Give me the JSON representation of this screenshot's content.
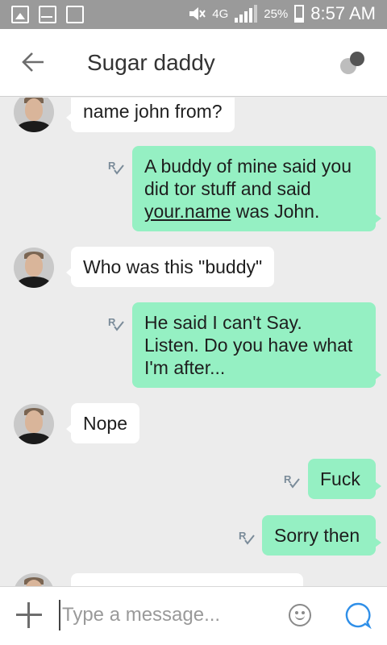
{
  "status_bar": {
    "network": "4G",
    "battery_percent": "25%",
    "time": "8:57 AM",
    "icons": [
      "image-icon",
      "mail-icon",
      "screenshot-icon",
      "mute-icon",
      "signal-icon",
      "battery-icon"
    ]
  },
  "header": {
    "title": "Sugar daddy",
    "back_icon": "arrow-left-icon",
    "contact_icon": "contact-icon"
  },
  "messages": [
    {
      "direction": "in",
      "lines": [
        "name john from?"
      ]
    },
    {
      "direction": "out",
      "lines": [
        "A buddy of mine said you",
        "did tor stuff and said",
        "your.name was John."
      ],
      "underlined": "your.name"
    },
    {
      "direction": "in",
      "lines": [
        "Who was this \"buddy\""
      ]
    },
    {
      "direction": "out",
      "lines": [
        "He said I can't Say.",
        "Listen. Do you have what",
        "I'm after..."
      ]
    },
    {
      "direction": "in",
      "lines": [
        "Nope"
      ]
    },
    {
      "direction": "out",
      "lines": [
        "Fuck"
      ]
    },
    {
      "direction": "out",
      "lines": [
        "Sorry then"
      ]
    }
  ],
  "input": {
    "placeholder": "Type a message...",
    "value": ""
  },
  "colors": {
    "outgoing_bubble": "#95f0c3",
    "incoming_bubble": "#ffffff",
    "status_bar": "#9a9a9a",
    "read_receipt": "#7a8b99"
  }
}
